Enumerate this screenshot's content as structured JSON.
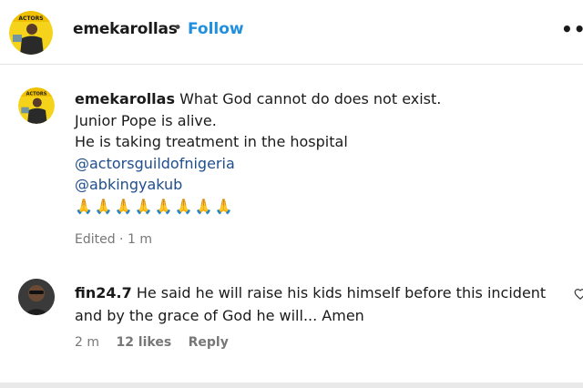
{
  "header": {
    "username": "emekarollas",
    "separator": "•",
    "follow_label": "Follow",
    "more_label": "•••"
  },
  "caption": {
    "username": "emekarollas",
    "line1": "What God cannot do does not exist.",
    "line2": "Junior Pope is alive.",
    "line3": "He is taking treatment in the hospital",
    "mention1": "@actorsguildofnigeria",
    "mention2": "@abkingyakub",
    "emoji": "🙏🙏🙏🙏🙏🙏🙏🙏",
    "meta": "Edited · 1 m"
  },
  "comment": {
    "username": "fin24.7",
    "text": "He said he will raise his kids himself before this incident and by the grace of God he will... Amen",
    "time": "2 m",
    "likes": "12 likes",
    "reply_label": "Reply"
  },
  "colors": {
    "accent": "#1f8fe0",
    "mention": "#1f4e8c",
    "meta": "#777777",
    "emoji": "#e8a11a"
  },
  "icons": {
    "more": "more-options-icon",
    "like": "heart-icon"
  }
}
